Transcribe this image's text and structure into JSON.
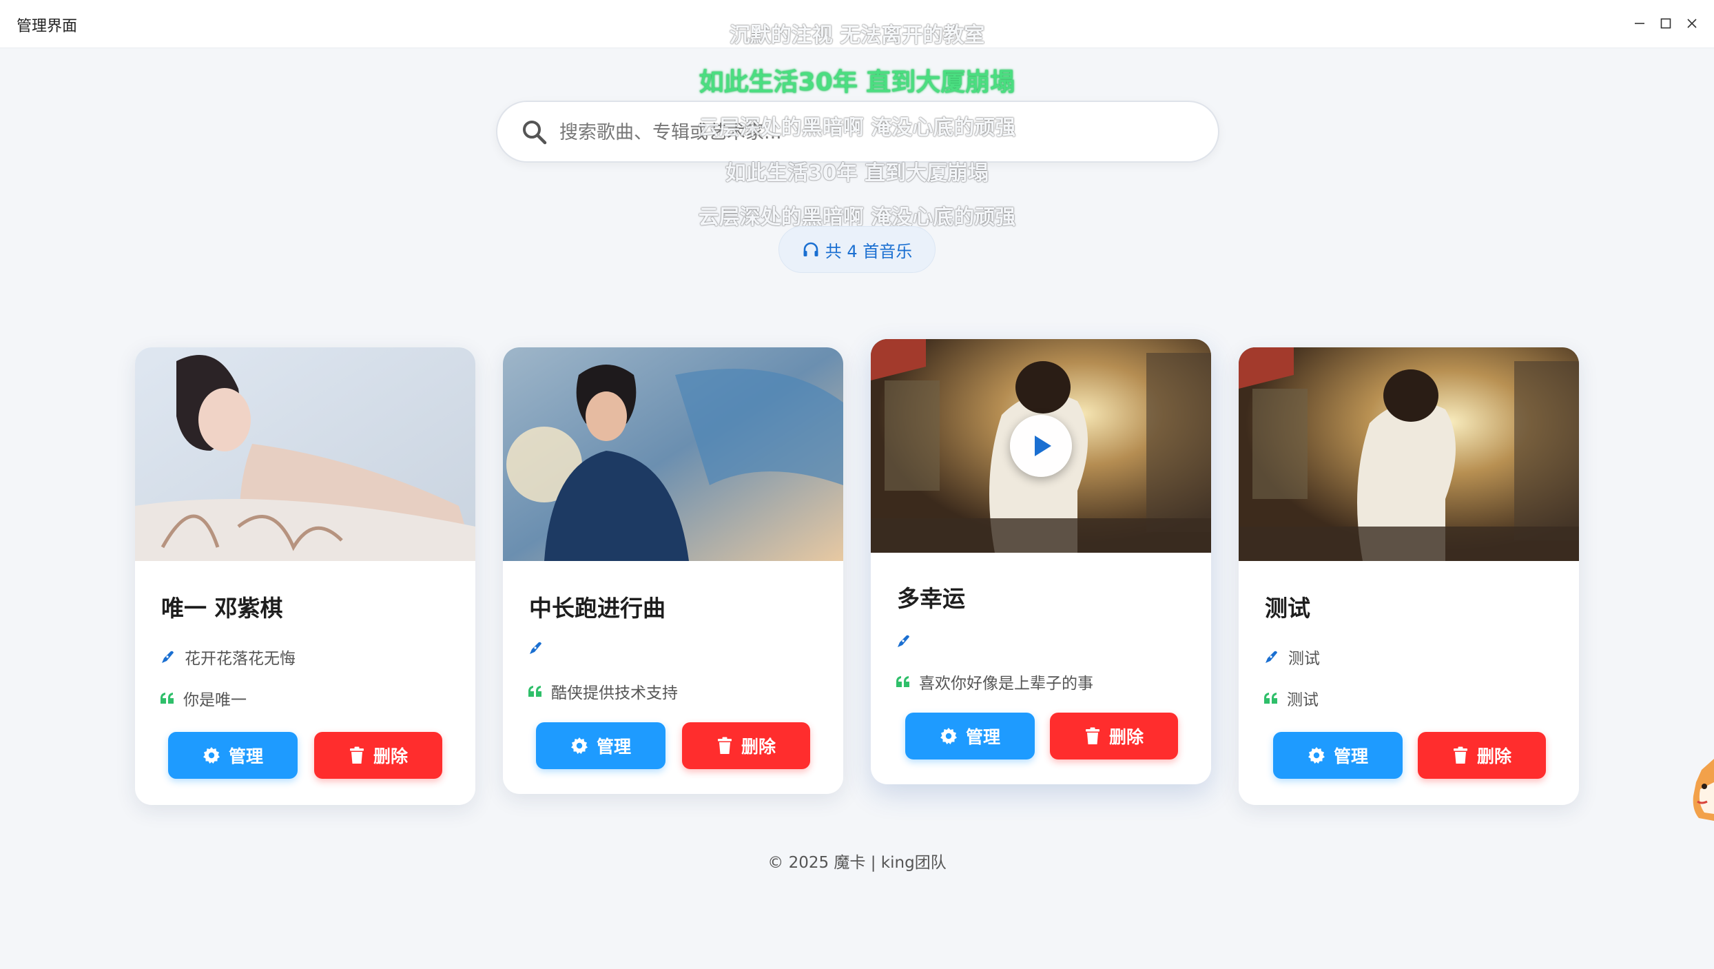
{
  "window": {
    "title": "管理界面",
    "controls": {
      "minimize": "–",
      "maximize": "☐",
      "close": "✕"
    }
  },
  "lyrics": [
    "沉默的注视 无法离开的教室",
    "如此生活30年 直到大厦崩塌",
    "云层深处的黑暗啊 淹没心底的顽强",
    "如此生活30年 直到大厦崩塌",
    "云层深处的黑暗啊 淹没心底的顽强"
  ],
  "search": {
    "placeholder": "搜索歌曲、专辑或艺术家...",
    "value": "",
    "icon": "search-icon"
  },
  "summary": {
    "icon": "headphones-icon",
    "label": "共 4 首音乐"
  },
  "cards": [
    {
      "title": "唯一 邓紫棋",
      "artist": "花开花落花无悔",
      "quote": "你是唯一",
      "manage_label": "管理",
      "delete_label": "删除"
    },
    {
      "title": "中长跑进行曲",
      "artist": "",
      "quote": "酷侠提供技术支持",
      "manage_label": "管理",
      "delete_label": "删除"
    },
    {
      "title": "多幸运",
      "artist": "",
      "quote": "喜欢你好像是上辈子的事",
      "manage_label": "管理",
      "delete_label": "删除"
    },
    {
      "title": "测试",
      "artist": "测试",
      "quote": "测试",
      "manage_label": "管理",
      "delete_label": "删除"
    }
  ],
  "footer": "© 2025 魔卡 | king团队",
  "colors": {
    "accent_blue": "#1e9bff",
    "danger_red": "#ff2d2d",
    "lyric_active": "#4ade80",
    "quote_green": "#2fbf6a",
    "pen_blue": "#1a6fd1"
  }
}
